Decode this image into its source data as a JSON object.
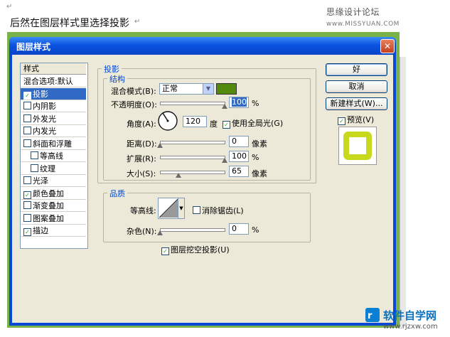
{
  "document": {
    "mark_top": "↵",
    "caption": "后然在图层样式里选择投影",
    "caption_mark": "↵",
    "watermark": "思缘设计论坛",
    "watermark_url": "www.MISSYUAN.COM"
  },
  "dialog": {
    "title": "图层样式",
    "close": "✕",
    "styles_header": "样式",
    "styles": [
      {
        "label": "混合选项:默认",
        "checkbox": false,
        "checked": false,
        "indent": false,
        "selected": false
      },
      {
        "label": "投影",
        "checkbox": true,
        "checked": true,
        "indent": false,
        "selected": true
      },
      {
        "label": "内阴影",
        "checkbox": true,
        "checked": false,
        "indent": false,
        "selected": false
      },
      {
        "label": "外发光",
        "checkbox": true,
        "checked": false,
        "indent": false,
        "selected": false
      },
      {
        "label": "内发光",
        "checkbox": true,
        "checked": false,
        "indent": false,
        "selected": false
      },
      {
        "label": "斜面和浮雕",
        "checkbox": true,
        "checked": false,
        "indent": false,
        "selected": false
      },
      {
        "label": "等高线",
        "checkbox": true,
        "checked": false,
        "indent": true,
        "selected": false
      },
      {
        "label": "纹理",
        "checkbox": true,
        "checked": false,
        "indent": true,
        "selected": false
      },
      {
        "label": "光泽",
        "checkbox": true,
        "checked": false,
        "indent": false,
        "selected": false
      },
      {
        "label": "颜色叠加",
        "checkbox": true,
        "checked": true,
        "indent": false,
        "selected": false
      },
      {
        "label": "渐变叠加",
        "checkbox": true,
        "checked": false,
        "indent": false,
        "selected": false
      },
      {
        "label": "图案叠加",
        "checkbox": true,
        "checked": false,
        "indent": false,
        "selected": false
      },
      {
        "label": "描边",
        "checkbox": true,
        "checked": true,
        "indent": false,
        "selected": false
      }
    ],
    "panel_title": "投影",
    "structure": {
      "title": "结构",
      "blend_mode_label": "混合模式(B):",
      "blend_mode_value": "正常",
      "shadow_color": "#538a0e",
      "opacity_label": "不透明度(O):",
      "opacity_value": "100",
      "opacity_unit": "%",
      "angle_label": "角度(A):",
      "angle_value": "120",
      "angle_unit": "度",
      "global_light_label": "使用全局光(G)",
      "global_light_checked": true,
      "distance_label": "距离(D):",
      "distance_value": "0",
      "distance_unit": "像素",
      "spread_label": "扩展(R):",
      "spread_value": "100",
      "spread_unit": "%",
      "size_label": "大小(S):",
      "size_value": "65",
      "size_unit": "像素"
    },
    "quality": {
      "title": "品质",
      "contour_label": "等高线:",
      "antialias_label": "消除锯齿(L)",
      "antialias_checked": false,
      "noise_label": "杂色(N):",
      "noise_value": "0",
      "noise_unit": "%"
    },
    "knockout_label": "图层挖空投影(U)",
    "knockout_checked": true,
    "buttons": {
      "ok": "好",
      "cancel": "取消",
      "new_style": "新建样式(W)...",
      "preview_label": "预览(V)",
      "preview_checked": true
    },
    "colors": {
      "preview_outer": "#c8d81c",
      "preview_inner": "#ffffff",
      "title_bar": "#0b53e0",
      "accent": "#0046d5"
    }
  },
  "watermark_bottom": {
    "brand": "软件自学网",
    "url": "www.rjzxw.com"
  }
}
